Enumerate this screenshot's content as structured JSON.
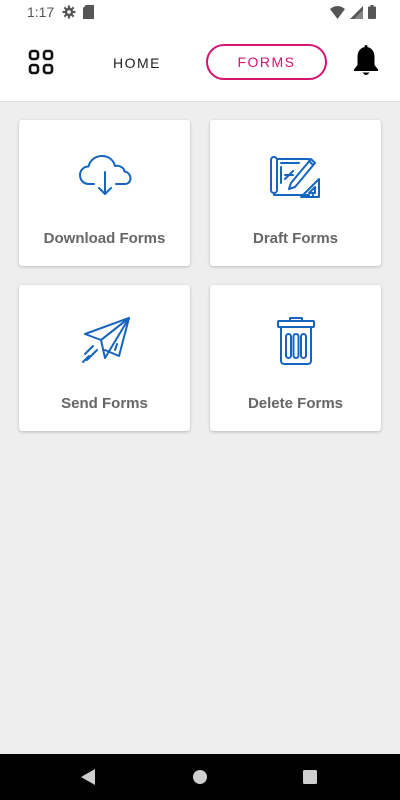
{
  "status_bar": {
    "time": "1:17",
    "left_icons": [
      "settings-icon",
      "sd-card-icon"
    ],
    "right_icons": [
      "wifi-icon",
      "cell-signal-icon",
      "battery-icon"
    ]
  },
  "header": {
    "menu_icon": "grid-icon",
    "tabs": [
      {
        "label": "HOME",
        "active": false
      },
      {
        "label": "FORMS",
        "active": true
      }
    ],
    "notification_icon": "bell-icon",
    "accent_color": "#d4146f"
  },
  "cards": [
    {
      "label": "Download Forms",
      "icon": "cloud-download-icon"
    },
    {
      "label": "Draft Forms",
      "icon": "blueprint-pencil-icon"
    },
    {
      "label": "Send Forms",
      "icon": "paper-plane-icon"
    },
    {
      "label": "Delete Forms",
      "icon": "trash-icon"
    }
  ],
  "icon_color": "#1565c0",
  "nav_bar": {
    "buttons": [
      "back-icon",
      "home-icon",
      "recents-icon"
    ]
  }
}
